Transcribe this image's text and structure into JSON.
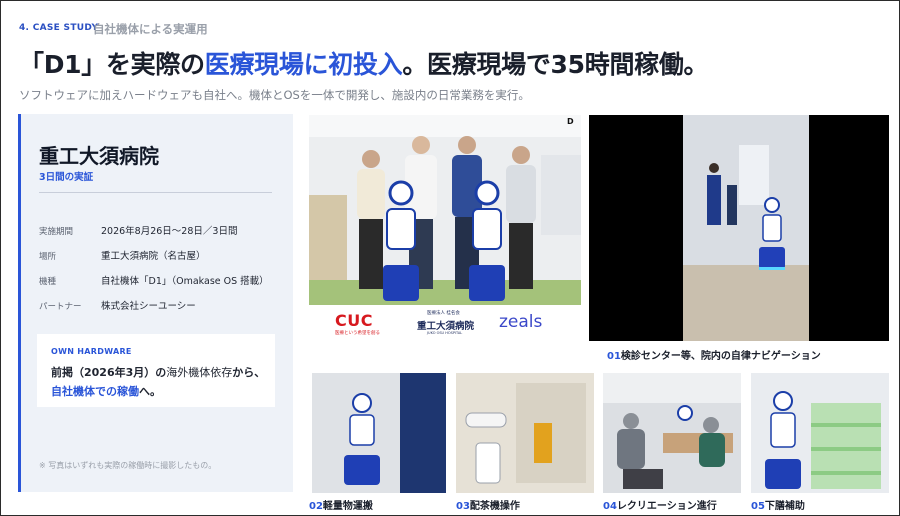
{
  "header": {
    "tag": "4. CASE STUDY",
    "tag_sub": "自社機体による実運用",
    "headline_a": "「D1」を実際の",
    "headline_b": "医療現場に初投入",
    "headline_c": "。医療現場で35時間稼働。",
    "subline": "ソフトウェアに加えハードウェアも自社へ。機体とOSを一体で開発し、施設内の日常業務を実行。"
  },
  "card": {
    "title": "重工大須病院",
    "subtitle": "3日間の実証",
    "rows": [
      {
        "k": "実施期間",
        "v": "2026年8月26日〜28日／3日間"
      },
      {
        "k": "場所",
        "v": "重工大須病院（名古屋）"
      },
      {
        "k": "機種",
        "v": "自社機体「D1」（Omakase OS 搭載）"
      },
      {
        "k": "パートナー",
        "v": "株式会社シーユーシー"
      }
    ],
    "box_label": "OWN HARDWARE",
    "box_a": "前掲（2026年3月）の",
    "box_b": "海外機体依存",
    "box_c": "から、",
    "box_d": "自社機体での稼働",
    "box_e": "へ。",
    "footnote": "※ 写真はいずれも実際の稼働時に撮影したもの。"
  },
  "logos": {
    "cuc": "CUC",
    "cuc_sub": "医療という希望を創る",
    "hosp_top": "医療法人 桂名会",
    "hosp": "重工大須病院",
    "hosp_sub": "JUKO OSU HOSPITAL",
    "zeals": "zeals",
    "d_mark": "D"
  },
  "captions": [
    {
      "n": "01",
      "t": "検診センター等、院内の自律ナビゲーション"
    },
    {
      "n": "02",
      "t": "軽量物運搬"
    },
    {
      "n": "03",
      "t": "配茶機操作"
    },
    {
      "n": "04",
      "t": "レクリエーション進行"
    },
    {
      "n": "05",
      "t": "下膳補助"
    }
  ],
  "colors": {
    "accent": "#2a55d8",
    "card_bg": "#eef2f8",
    "text": "#1a1f2b"
  }
}
